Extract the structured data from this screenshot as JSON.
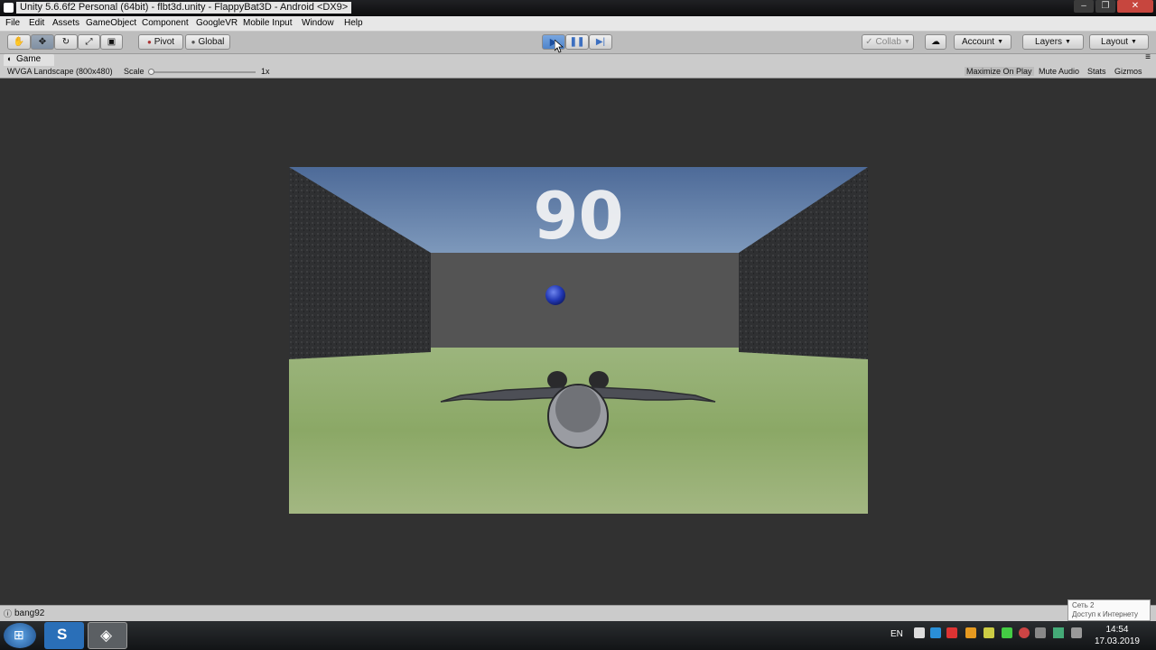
{
  "window": {
    "title": "Unity 5.6.6f2 Personal (64bit) - flbt3d.unity - FlappyBat3D - Android <DX9>",
    "min": "–",
    "max": "❐",
    "close": "✕"
  },
  "menu": [
    "File",
    "Edit",
    "Assets",
    "GameObject",
    "Component",
    "GoogleVR",
    "Mobile Input",
    "Window",
    "Help"
  ],
  "toolbar": {
    "pivot": "Pivot",
    "global": "Global",
    "collab": "Collab",
    "account": "Account",
    "layers": "Layers",
    "layout": "Layout"
  },
  "game_tab": {
    "label": "Game"
  },
  "game_bar": {
    "resolution": "WVGA Landscape (800x480)",
    "scale_label": "Scale",
    "scale_value": "1x",
    "maximize": "Maximize On Play",
    "mute": "Mute Audio",
    "stats": "Stats",
    "gizmos": "Gizmos"
  },
  "game": {
    "score": "90"
  },
  "status": {
    "text": "bang92"
  },
  "network_tooltip": {
    "line1": "Сеть 2",
    "line2": "Доступ к Интернету"
  },
  "taskbar": {
    "lang": "EN",
    "time": "14:54",
    "date": "17.03.2019"
  },
  "colors": {
    "play_active": "#3c7fd8",
    "sky": "#4f6f9c",
    "grass": "#93ad6e",
    "wall": "#2e2f31",
    "ball": "#2238b5"
  }
}
